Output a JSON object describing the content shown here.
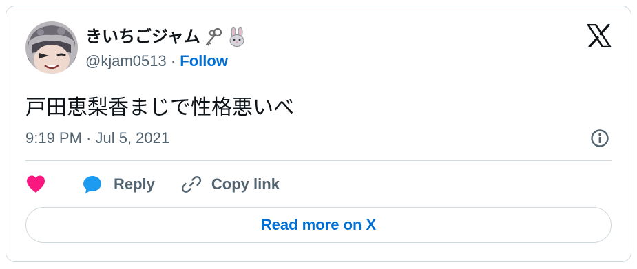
{
  "tweet": {
    "author": {
      "display_name": "きいちごジャム",
      "name_emojis": [
        "key-emoji",
        "rabbit-emoji"
      ],
      "handle": "@kjam0513",
      "separator": " · ",
      "follow_label": "Follow"
    },
    "text": "戸田恵梨香まじで性格悪いべ",
    "timestamp": "9:19 PM · Jul 5, 2021"
  },
  "actions": {
    "like_icon": "heart-icon",
    "reply_label": "Reply",
    "copy_link_label": "Copy link"
  },
  "footer": {
    "read_more_label": "Read more on X"
  },
  "colors": {
    "accent": "#006fd6",
    "like": "#f91880",
    "reply": "#1d9bf0",
    "muted_text": "#536471",
    "border": "#cfd9de"
  }
}
